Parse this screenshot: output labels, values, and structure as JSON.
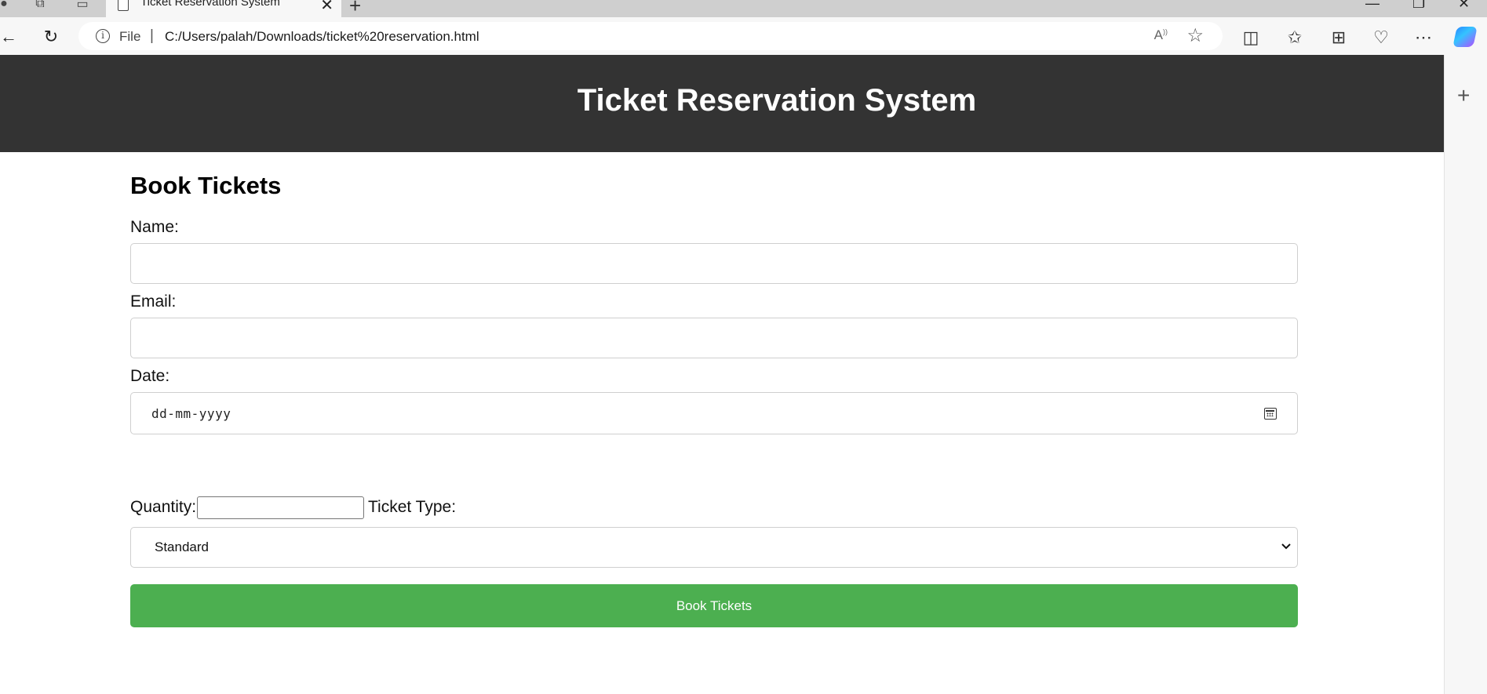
{
  "browser": {
    "tab_title": "Ticket Reservation System",
    "tab_close": "✕",
    "new_tab": "+",
    "address": {
      "scheme_label": "File",
      "separator": "|",
      "url": "C:/Users/palah/Downloads/ticket%20reservation.html"
    },
    "sidebar_add": "+"
  },
  "page": {
    "header_title": "Ticket Reservation System",
    "form": {
      "heading": "Book Tickets",
      "name_label": "Name:",
      "name_value": "",
      "email_label": "Email:",
      "email_value": "",
      "date_label": "Date:",
      "date_placeholder": "dd-mm-yyyy",
      "quantity_label": "Quantity:",
      "quantity_value": "",
      "ticket_type_label": "Ticket Type:",
      "ticket_type_selected": "Standard",
      "submit_label": "Book Tickets"
    }
  },
  "colors": {
    "header_bg": "#333333",
    "button_bg": "#4caf50",
    "button_text": "#ffffff"
  }
}
